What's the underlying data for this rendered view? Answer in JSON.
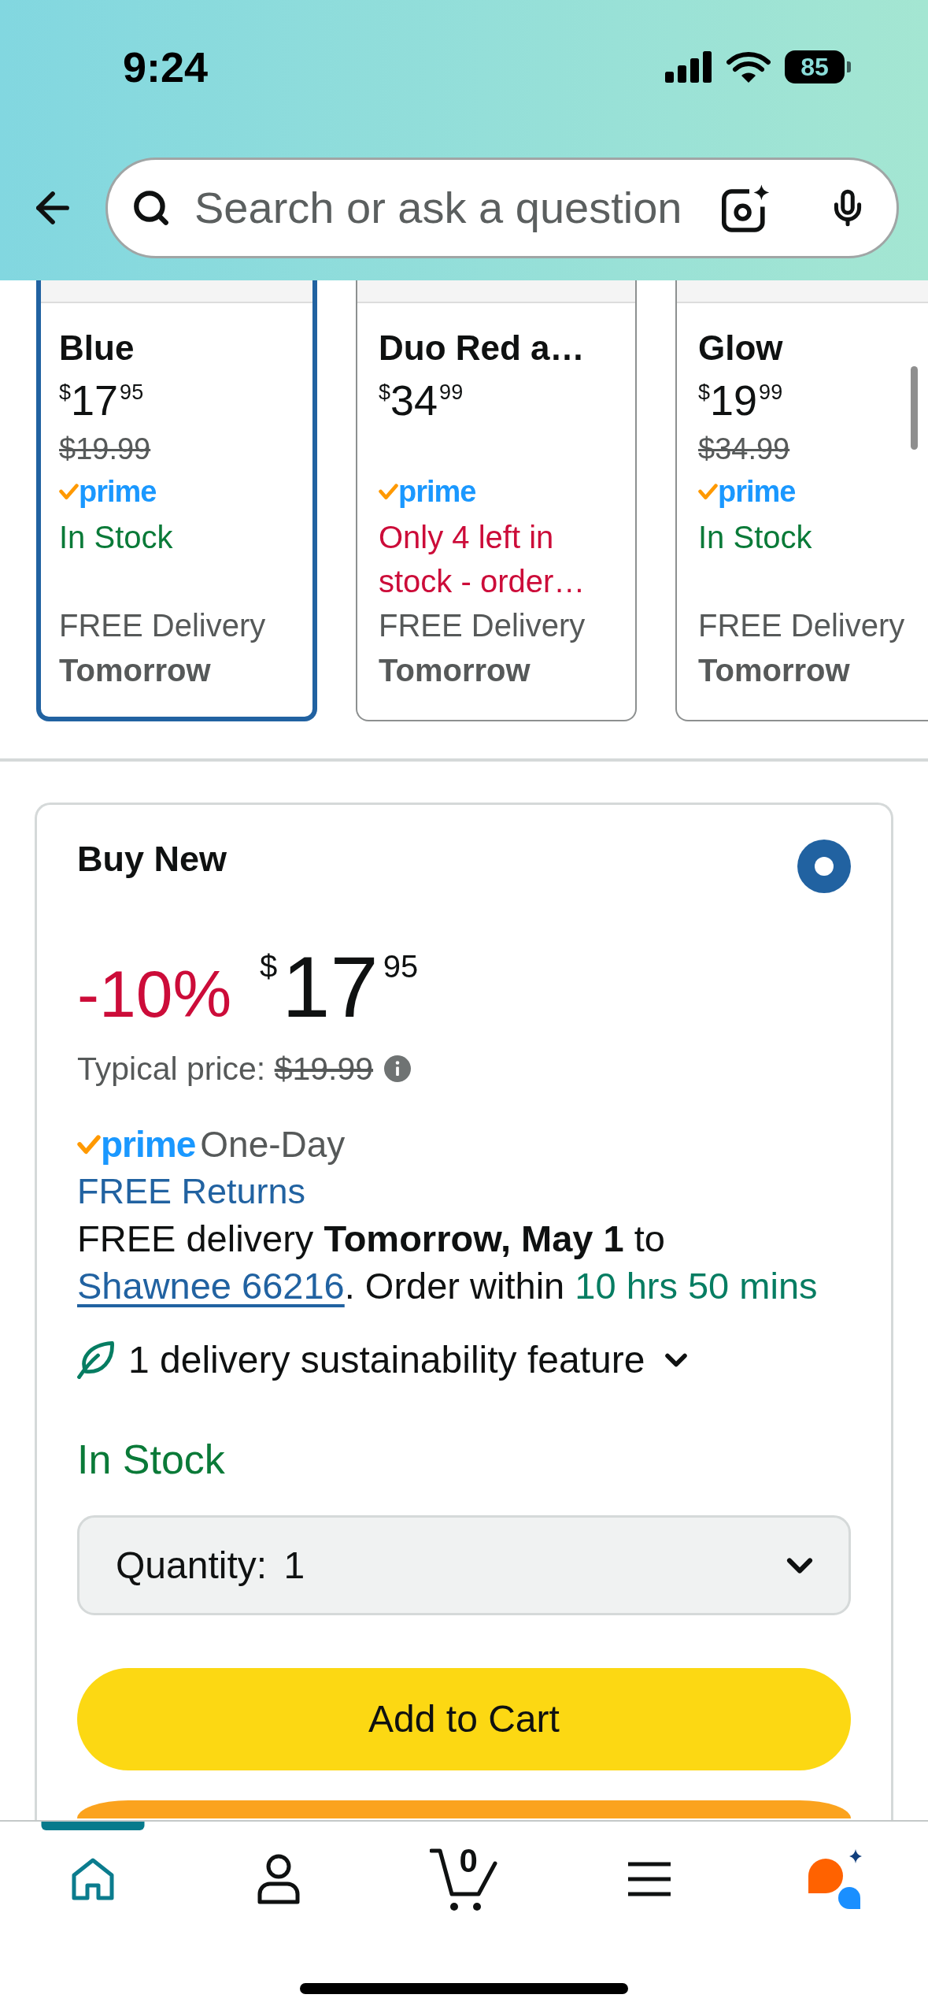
{
  "status_bar": {
    "time": "9:24",
    "battery": "85"
  },
  "header": {
    "search": {
      "placeholder": "Search or ask a question"
    }
  },
  "variants": [
    {
      "name": "Blue",
      "price": {
        "currency": "$",
        "whole": "17",
        "fraction": "95"
      },
      "list_price": "$19.99",
      "prime_label": "prime",
      "availability": {
        "text": "In Stock",
        "kind": "in_stock"
      },
      "delivery": "FREE Delivery",
      "delivery_day": "Tomorrow",
      "selected": true
    },
    {
      "name": "Duo Red a…",
      "price": {
        "currency": "$",
        "whole": "34",
        "fraction": "99"
      },
      "prime_label": "prime",
      "availability": {
        "text": "Only 4 left in stock - order…",
        "kind": "low_stock"
      },
      "delivery": "FREE Delivery",
      "delivery_day": "Tomorrow",
      "selected": false
    },
    {
      "name": "Glow",
      "price": {
        "currency": "$",
        "whole": "19",
        "fraction": "99"
      },
      "list_price": "$34.99",
      "prime_label": "prime",
      "availability": {
        "text": "In Stock",
        "kind": "in_stock"
      },
      "delivery": "FREE Delivery",
      "delivery_day": "Tomorrow",
      "selected": false
    }
  ],
  "buy_box": {
    "title": "Buy New",
    "selected": true,
    "discount": "-10%",
    "price": {
      "currency": "$",
      "whole": "17",
      "fraction": "95"
    },
    "typical_price": {
      "label": "Typical price:",
      "value": "$19.99"
    },
    "prime_label": "prime",
    "prime_speed": "One-Day",
    "returns": "FREE Returns",
    "delivery": [
      {
        "kind": "plain",
        "text": "FREE delivery "
      },
      {
        "kind": "bold",
        "text": "Tomorrow, May 1"
      },
      {
        "kind": "plain",
        "text": " to "
      },
      {
        "kind": "link",
        "text": "Shawnee 66216"
      },
      {
        "kind": "plain",
        "text": ". Order within "
      },
      {
        "kind": "highlight",
        "text": "10 hrs 50 mins"
      }
    ],
    "sustainability": {
      "text": "1 delivery sustainability feature",
      "expanded": false
    },
    "availability": {
      "text": "In Stock",
      "kind": "in_stock"
    },
    "quantity": {
      "label": "Quantity:",
      "value": "1"
    },
    "buttons": [
      {
        "kind": "primary",
        "label": "Add to Cart"
      },
      {
        "kind": "secondary_cut"
      }
    ]
  },
  "nav": {
    "items": [
      {
        "kind": "home",
        "selected": true
      },
      {
        "kind": "account",
        "selected": false
      },
      {
        "kind": "cart",
        "selected": false,
        "count": "0"
      },
      {
        "kind": "menu",
        "selected": false
      },
      {
        "kind": "assistant",
        "selected": false
      }
    ]
  }
}
